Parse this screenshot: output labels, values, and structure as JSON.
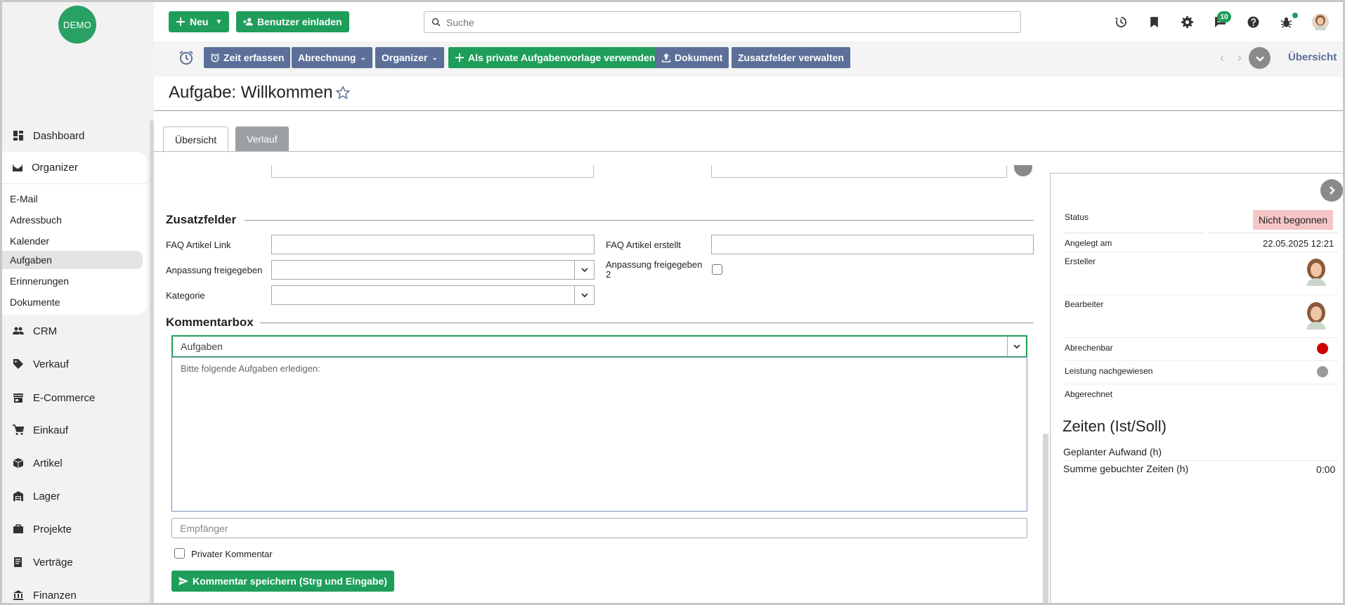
{
  "brand": {
    "logo_text": "DEMO"
  },
  "sidebar": {
    "items": [
      {
        "key": "dashboard",
        "label": "Dashboard"
      },
      {
        "key": "organizer",
        "label": "Organizer"
      },
      {
        "key": "crm",
        "label": "CRM"
      },
      {
        "key": "verkauf",
        "label": "Verkauf"
      },
      {
        "key": "ecommerce",
        "label": "E-Commerce"
      },
      {
        "key": "einkauf",
        "label": "Einkauf"
      },
      {
        "key": "artikel",
        "label": "Artikel"
      },
      {
        "key": "lager",
        "label": "Lager"
      },
      {
        "key": "projekte",
        "label": "Projekte"
      },
      {
        "key": "vertraege",
        "label": "Verträge"
      },
      {
        "key": "finanzen",
        "label": "Finanzen"
      }
    ],
    "organizer_sub": [
      {
        "label": "E-Mail"
      },
      {
        "label": "Adressbuch"
      },
      {
        "label": "Kalender"
      },
      {
        "label": "Aufgaben",
        "active": true
      },
      {
        "label": "Erinnerungen"
      },
      {
        "label": "Dokumente"
      }
    ]
  },
  "topbar": {
    "new_label": "Neu",
    "invite_label": "Benutzer einladen",
    "search_placeholder": "Suche",
    "messages_badge": "10",
    "icons": [
      "history-icon",
      "bookmark-icon",
      "gear-icon",
      "chat-icon",
      "help-icon",
      "bug-icon",
      "user-avatar"
    ]
  },
  "toolbar": {
    "time_record": "Zeit erfassen",
    "billing": "Abrechnung",
    "organizer": "Organizer",
    "private_template": "Als private Aufgabenvorlage verwenden",
    "document": "Dokument",
    "extra_fields": "Zusatzfelder verwalten",
    "overview": "Übersicht"
  },
  "page": {
    "title": "Aufgabe: Willkommen"
  },
  "tabs": [
    {
      "label": "Übersicht",
      "active": true
    },
    {
      "label": "Verlauf",
      "active": false
    }
  ],
  "zusatzfelder": {
    "heading": "Zusatzfelder",
    "faq_link_label": "FAQ Artikel Link",
    "faq_link_value": "",
    "faq_created_label": "FAQ Artikel erstellt",
    "faq_created_value": "",
    "adjust_label": "Anpassung freigegeben",
    "adjust_value": "",
    "adjust2_label_line1": "Anpassung freigegeben",
    "adjust2_label_line2": "2",
    "adjust2_checked": false,
    "category_label": "Kategorie",
    "category_value": ""
  },
  "kommentarbox": {
    "heading": "Kommentarbox",
    "template_value": "Aufgaben",
    "text": "Bitte folgende Aufgaben erledigen:",
    "recipient_placeholder": "Empfänger",
    "private_label": "Privater Kommentar",
    "private_checked": false,
    "save_label": "Kommentar speichern (Strg und Eingabe)"
  },
  "details": {
    "status_label": "Status",
    "status_value": "Nicht begonnen",
    "created_label": "Angelegt am",
    "created_value": "22.05.2025 12:21",
    "creator_label": "Ersteller",
    "assignee_label": "Bearbeiter",
    "billable_label": "Abrechenbar",
    "billable_color": "#cc0000",
    "performance_label": "Leistung nachgewiesen",
    "performance_color": "#9a9a9a",
    "billed_label": "Abgerechnet"
  },
  "zeiten": {
    "heading": "Zeiten (Ist/Soll)",
    "planned_label": "Geplanter Aufwand (h)",
    "planned_value": "",
    "booked_label": "Summe gebuchter Zeiten (h)",
    "booked_value": "0:00"
  },
  "colors": {
    "accent_green": "#1e9e5a",
    "toolbar_blue": "#5b6f99",
    "status_bg": "#f5c6c6"
  }
}
